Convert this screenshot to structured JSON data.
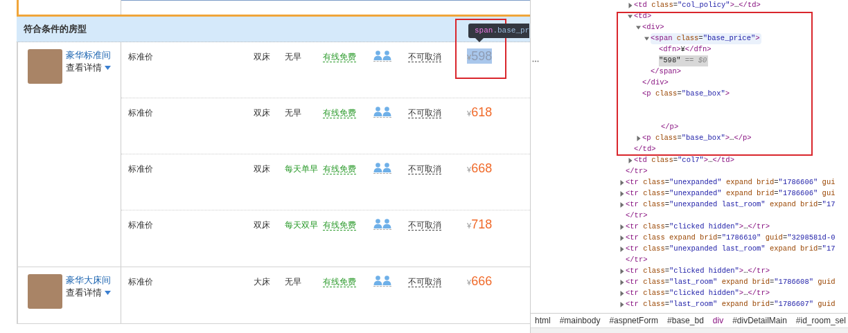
{
  "page": {
    "section_title": "符合条件的房型",
    "rooms": [
      {
        "name": "豪华标准间",
        "details": "查看详情",
        "rates": [
          {
            "plan": "标准价",
            "bed": "双床",
            "breakfast": "无早",
            "breakfast_included": false,
            "wifi": "有线免费",
            "policy": "不可取消",
            "currency": "¥",
            "price": "598",
            "highlighted": true
          },
          {
            "plan": "标准价",
            "bed": "双床",
            "breakfast": "无早",
            "breakfast_included": false,
            "wifi": "有线免费",
            "policy": "不可取消",
            "currency": "¥",
            "price": "618",
            "highlighted": false
          },
          {
            "plan": "标准价",
            "bed": "双床",
            "breakfast": "每天单早",
            "breakfast_included": true,
            "wifi": "有线免费",
            "policy": "不可取消",
            "currency": "¥",
            "price": "668",
            "highlighted": false
          },
          {
            "plan": "标准价",
            "bed": "双床",
            "breakfast": "每天双早",
            "breakfast_included": true,
            "wifi": "有线免费",
            "policy": "不可取消",
            "currency": "¥",
            "price": "718",
            "highlighted": false
          }
        ]
      },
      {
        "name": "豪华大床间",
        "details": "查看详情",
        "rates": [
          {
            "plan": "标准价",
            "bed": "大床",
            "breakfast": "无早",
            "breakfast_included": false,
            "wifi": "有线免费",
            "policy": "不可取消",
            "currency": "¥",
            "price": "666",
            "highlighted": false
          }
        ]
      }
    ],
    "inspect_tooltip": {
      "tag": "span",
      "selector": ".base_pr"
    }
  },
  "devtools": {
    "elements": [
      {
        "closing": "</tr>",
        "children": [
          {
            "text": "<td class=\"col_policy\">…</td>",
            "expanded": false,
            "selected": false,
            "hovered": false
          },
          {
            "text": "<td>",
            "expanded": true,
            "selected": false,
            "hovered": false,
            "closing": "</td>",
            "children": [
              {
                "text": "<div>",
                "expanded": true,
                "selected": false,
                "hovered": false,
                "closing": "</div>",
                "children": [
                  {
                    "text": "<span class=\"base_price\">",
                    "expanded": true,
                    "selected": false,
                    "hovered": true,
                    "closing": "</span>",
                    "children": [
                      {
                        "text": "<dfn>¥</dfn>",
                        "selected": false,
                        "hovered": false
                      },
                      {
                        "text": "\"598\" == $0",
                        "selected": true,
                        "hovered": false
                      }
                    ]
                  }
                ]
              },
              {
                "text": "<p class=\"base_box\">",
                "selected": false,
                "hovered": false,
                "closing": "</p>",
                "whitespace": true
              },
              {
                "text": "<p class=\"base_box\">…</p>",
                "expanded": false,
                "selected": false,
                "hovered": false
              }
            ]
          },
          {
            "text": "<td class=\"col7\">…</td>",
            "expanded": false,
            "selected": false,
            "hovered": false
          }
        ]
      },
      {
        "text": "<tr class=\"unexpanded\" expand brid=\"1786606\" gui",
        "expanded": false,
        "selected": false,
        "hovered": false
      },
      {
        "text": "<tr class=\"unexpanded\" expand brid=\"1786606\" gui",
        "expanded": false,
        "selected": false,
        "hovered": false
      },
      {
        "text": "<tr class=\"unexpanded last_room\" expand brid=\"17",
        "expanded": false,
        "selected": false,
        "hovered": false
      },
      {
        "text": "</tr>",
        "selected": false,
        "hovered": false
      },
      {
        "text": "<tr class=\"clicked hidden\">…</tr>",
        "expanded": false,
        "selected": false,
        "hovered": false
      },
      {
        "text": "<tr class expand brid=\"1786610\" guid=\"3298581d-0",
        "expanded": false,
        "selected": false,
        "hovered": false
      },
      {
        "text": "<tr class=\"unexpanded last_room\" expand brid=\"17",
        "expanded": false,
        "selected": false,
        "hovered": false
      },
      {
        "text": "</tr>",
        "selected": false,
        "hovered": false
      },
      {
        "text": "<tr class=\"clicked hidden\">…</tr>",
        "expanded": false,
        "selected": false,
        "hovered": false
      },
      {
        "text": "<tr class=\"last_room\" expand brid=\"1786608\" guid",
        "expanded": false,
        "selected": false,
        "hovered": false
      },
      {
        "text": "<tr class=\"clicked hidden\">…</tr>",
        "expanded": false,
        "selected": false,
        "hovered": false
      },
      {
        "text": "<tr class=\"last_room\" expand brid=\"1786607\" guid",
        "expanded": false,
        "selected": false,
        "hovered": false
      }
    ],
    "breadcrumbs": [
      {
        "label": "html",
        "color": "#333333"
      },
      {
        "label": "#mainbody",
        "color": "#333333"
      },
      {
        "label": "#aspnetForm",
        "color": "#333333"
      },
      {
        "label": "#base_bd",
        "color": "#333333"
      },
      {
        "label": "div",
        "color": "#881280"
      },
      {
        "label": "#divDetailMain",
        "color": "#333333"
      },
      {
        "label": "#id_room_sel",
        "color": "#333333"
      }
    ]
  }
}
